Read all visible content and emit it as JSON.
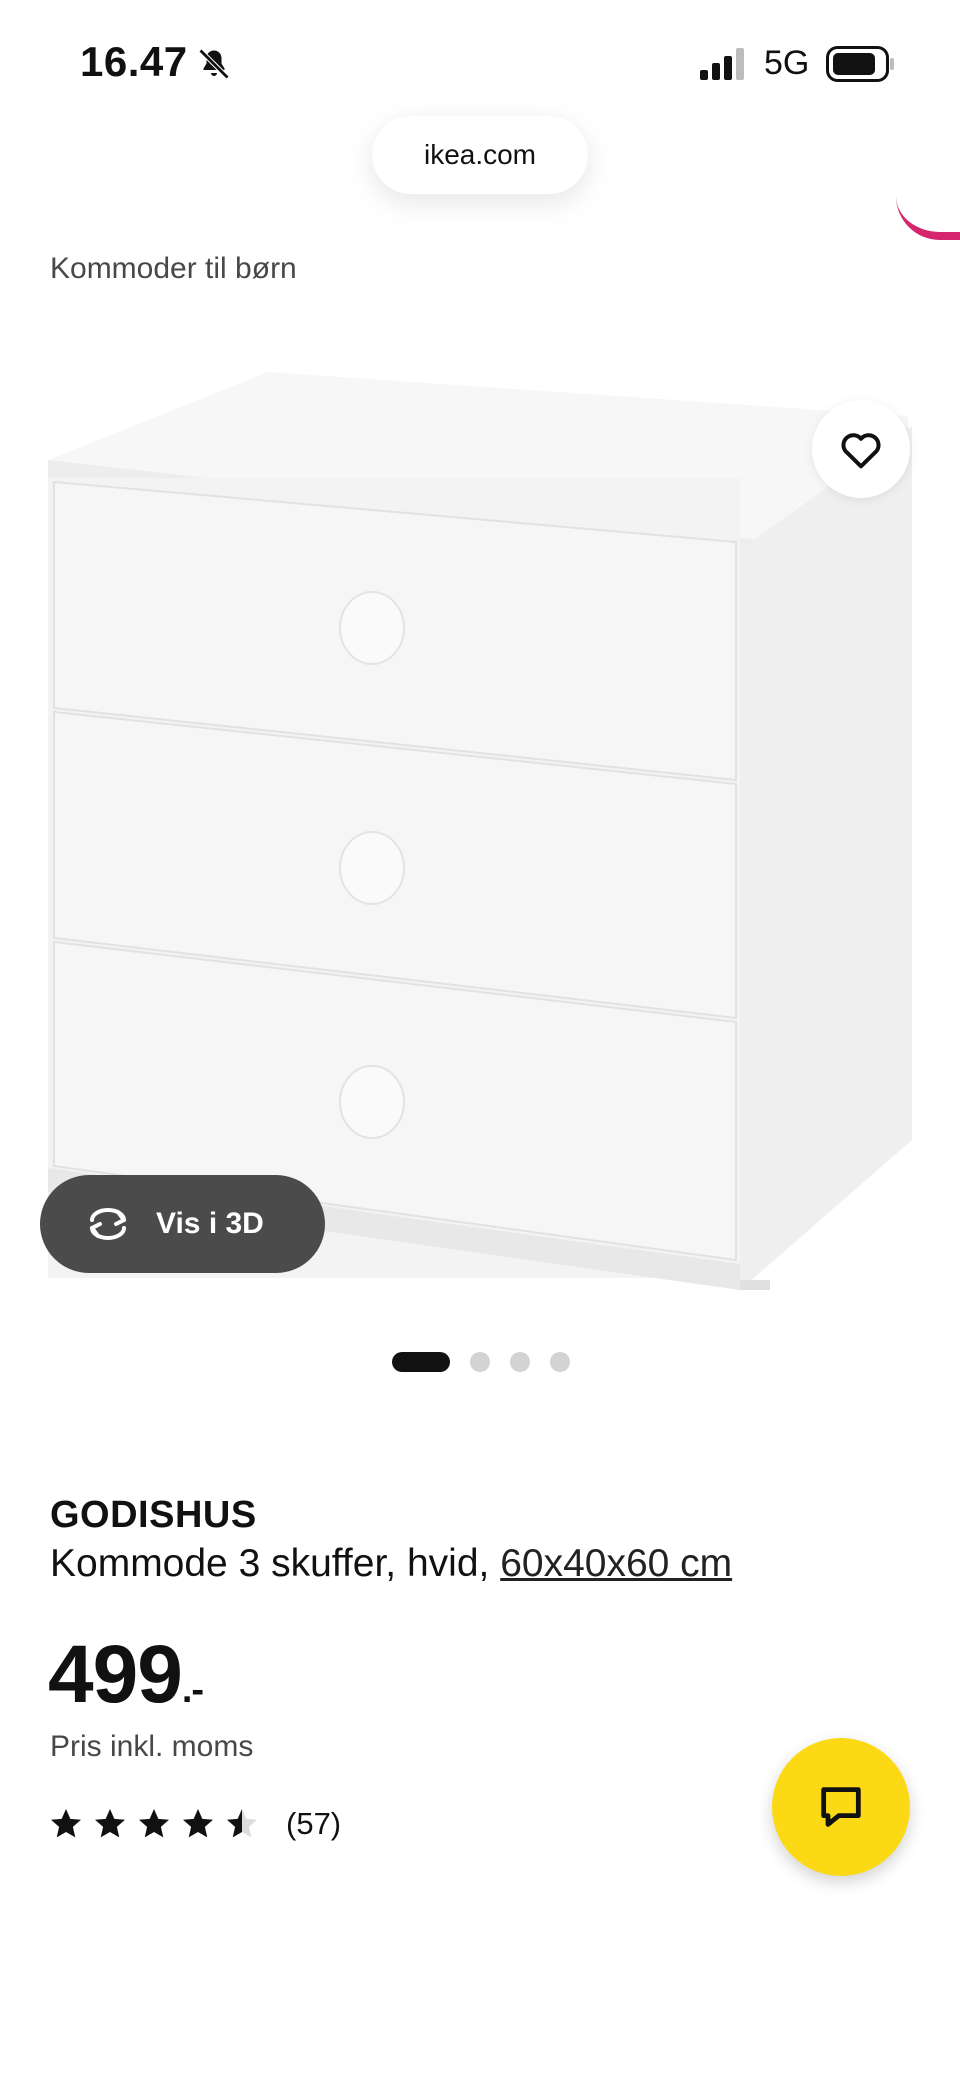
{
  "status_bar": {
    "time": "16.47",
    "network": "5G"
  },
  "browser": {
    "url": "ikea.com"
  },
  "breadcrumb": "Kommoder til børn",
  "image": {
    "view_3d_label": "Vis i 3D",
    "carousel_count": 4,
    "carousel_active_index": 0
  },
  "product": {
    "name": "GODISHUS",
    "description": "Kommode 3 skuffer, hvid, ",
    "dimensions": "60x40x60 cm",
    "price": "499",
    "price_suffix": ".-",
    "price_note": "Pris inkl. moms",
    "rating_value": 4.5,
    "rating_max": 5,
    "review_count": "(57)"
  },
  "colors": {
    "chat_button": "#fbd914",
    "accent_pink": "#d6246e",
    "vis3d_bg": "#4b4b4b"
  },
  "icons": [
    "bell-slash-icon",
    "signal-icon",
    "battery-icon",
    "heart-icon",
    "rotate-3d-icon",
    "star-icon",
    "chat-icon"
  ]
}
